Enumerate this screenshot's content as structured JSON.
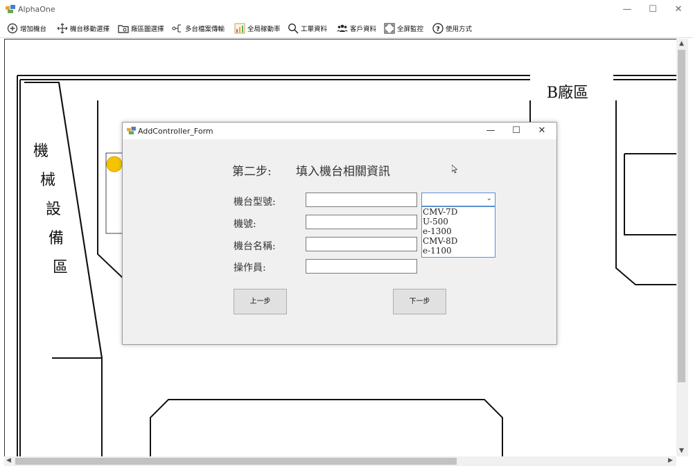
{
  "window": {
    "title": "AlphaOne",
    "minimize": "—",
    "maximize": "☐",
    "close": "✕"
  },
  "toolbar": [
    {
      "label": "增加機台",
      "icon": "add-circle-icon"
    },
    {
      "label": "機台移動選擇",
      "icon": "move-icon"
    },
    {
      "label": "廠區圖選擇",
      "icon": "folder-settings-icon"
    },
    {
      "label": "多台檔案傳輸",
      "icon": "transfer-icon"
    },
    {
      "label": "全局稼動率",
      "icon": "bar-chart-icon"
    },
    {
      "label": "工單資料",
      "icon": "search-icon"
    },
    {
      "label": "客戶資料",
      "icon": "users-icon"
    },
    {
      "label": "全屏監控",
      "icon": "fullscreen-icon"
    },
    {
      "label": "使用方式",
      "icon": "help-icon"
    }
  ],
  "floor": {
    "area_b_label": "B廠區",
    "machine_area_label": "機械設備區"
  },
  "dialog": {
    "title": "AddController_Form",
    "step_title": "第二步:",
    "step_subtitle": "填入機台相關資訊",
    "fields": [
      {
        "label": "機台型號:",
        "value": ""
      },
      {
        "label": "機號:",
        "value": ""
      },
      {
        "label": "機台名稱:",
        "value": ""
      },
      {
        "label": "操作員:",
        "value": ""
      }
    ],
    "model_options": [
      "CMV-7D",
      "U-500",
      "e-1300",
      "CMV-8D",
      "e-1100"
    ],
    "prev_button": "上一步",
    "next_button": "下一步"
  },
  "colors": {
    "accent": "#5a8fd0",
    "badge": "#f5c400"
  }
}
